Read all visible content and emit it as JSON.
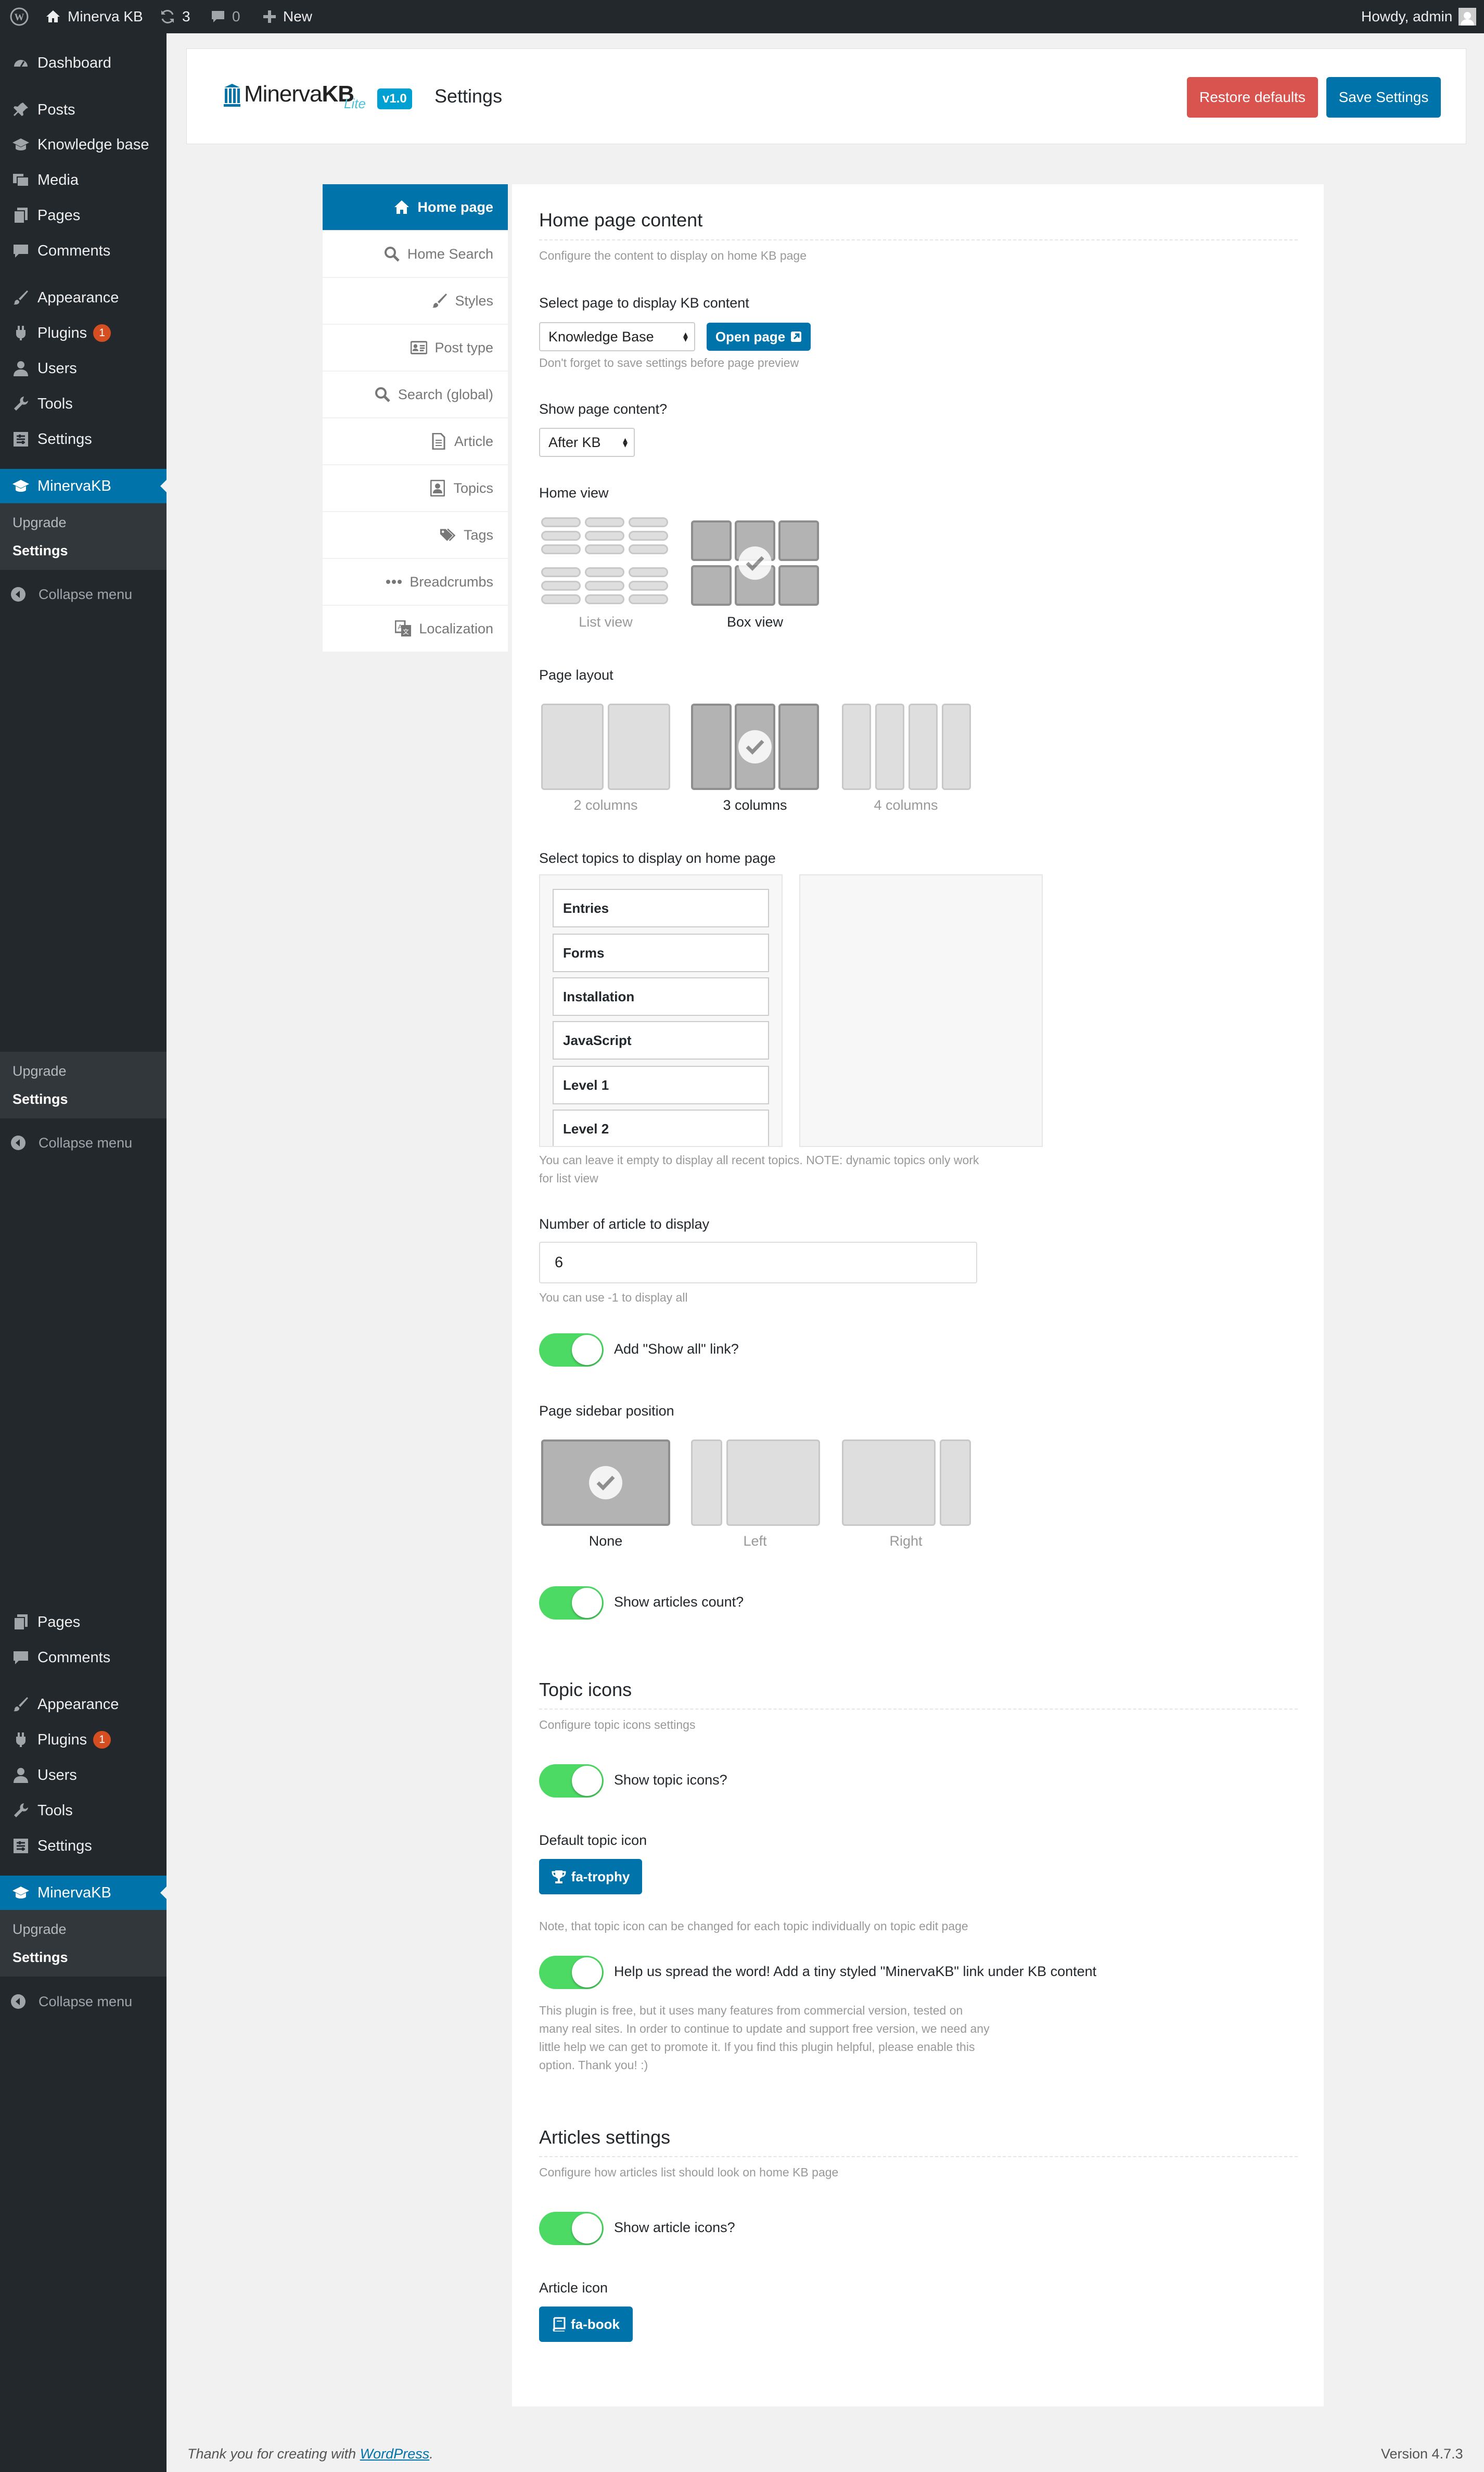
{
  "adminbar": {
    "site_name": "Minerva KB",
    "updates_count": "3",
    "comments_count": "0",
    "new_label": "New",
    "howdy": "Howdy, admin"
  },
  "menu": {
    "dashboard": "Dashboard",
    "posts": "Posts",
    "knowledge_base": "Knowledge base",
    "media": "Media",
    "pages": "Pages",
    "comments": "Comments",
    "appearance": "Appearance",
    "plugins": "Plugins",
    "plugins_badge": "1",
    "users": "Users",
    "tools": "Tools",
    "settings": "Settings",
    "minervakb": "MinervaKB",
    "upgrade": "Upgrade",
    "sub_settings": "Settings",
    "collapse": "Collapse menu"
  },
  "header": {
    "logo_name": "Minerva",
    "logo_kb": "KB",
    "logo_lite": "Lite",
    "version": "v1.0",
    "title": "Settings",
    "restore_label": "Restore defaults",
    "save_label": "Save Settings"
  },
  "tabs": [
    {
      "label": "Home page",
      "icon": "home-icon"
    },
    {
      "label": "Home Search",
      "icon": "search-icon"
    },
    {
      "label": "Styles",
      "icon": "paint-brush-icon"
    },
    {
      "label": "Post type",
      "icon": "id-card-icon"
    },
    {
      "label": "Search (global)",
      "icon": "search-icon"
    },
    {
      "label": "Article",
      "icon": "file-icon"
    },
    {
      "label": "Topics",
      "icon": "portrait-icon"
    },
    {
      "label": "Tags",
      "icon": "tags-icon"
    },
    {
      "label": "Breadcrumbs",
      "icon": "ellipsis-icon"
    },
    {
      "label": "Localization",
      "icon": "translate-icon"
    }
  ],
  "home": {
    "title": "Home page content",
    "desc": "Configure the content to display on home KB page",
    "select_page_label": "Select page to display KB content",
    "select_page_value": "Knowledge Base",
    "open_page_label": "Open page",
    "select_page_note": "Don't forget to save settings before page preview",
    "show_content_label": "Show page content?",
    "show_content_value": "After KB",
    "home_view_label": "Home view",
    "list_view": "List view",
    "box_view": "Box view",
    "page_layout_label": "Page layout",
    "layout_2": "2 columns",
    "layout_3": "3 columns",
    "layout_4": "4 columns",
    "topics_label": "Select topics to display on home page",
    "topics": [
      "Entries",
      "Forms",
      "Installation",
      "JavaScript",
      "Level 1",
      "Level 2"
    ],
    "topics_note_1": "You can leave it empty to display all recent topics. NOTE: dynamic topics only work",
    "topics_note_2": "for list view",
    "num_articles_label": "Number of article to display",
    "num_articles_value": "6",
    "num_articles_note": "You can use -1 to display all",
    "show_all_label": "Add \"Show all\" link?",
    "sidebar_pos_label": "Page sidebar position",
    "sidebar_none": "None",
    "sidebar_left": "Left",
    "sidebar_right": "Right",
    "show_count_label": "Show articles count?"
  },
  "topic_icons": {
    "title": "Topic icons",
    "desc": "Configure topic icons settings",
    "show_label": "Show topic icons?",
    "default_label": "Default topic icon",
    "default_value": "fa-trophy",
    "note": "Note, that topic icon can be changed for each topic individually on topic edit page",
    "spread_label": "Help us spread the word! Add a tiny styled \"MinervaKB\" link under KB content",
    "spread_note_1": "This plugin is free, but it uses many features from commercial version, tested on",
    "spread_note_2": "many real sites. In order to continue to update and support free version, we need any",
    "spread_note_3": "little help we can get to promote it. If you find this plugin helpful, please enable this",
    "spread_note_4": "option. Thank you! :)"
  },
  "articles": {
    "title": "Articles settings",
    "desc": "Configure how articles list should look on home KB page",
    "show_icons_label": "Show article icons?",
    "icon_label": "Article icon",
    "icon_value": "fa-book"
  },
  "footer": {
    "thanks_prefix": "Thank you for creating with",
    "thanks_link": "WordPress",
    "thanks_suffix": ".",
    "version": "Version 4.7.3"
  },
  "colors": {
    "accent": "#0073aa",
    "danger": "#d9534f",
    "toggle_on": "#4cd964",
    "sidebar_bg": "#23282d"
  }
}
